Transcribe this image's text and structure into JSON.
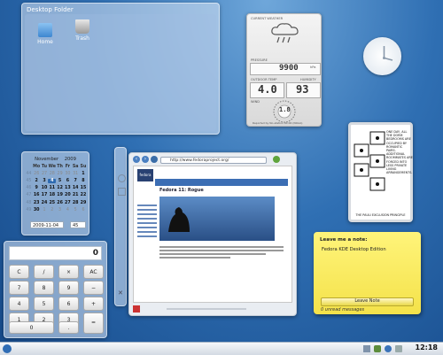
{
  "desktop_folder": {
    "title": "Desktop Folder",
    "icons": [
      {
        "label": "Home",
        "icon": "home-folder-icon"
      },
      {
        "label": "Trash",
        "icon": "trash-icon"
      }
    ]
  },
  "weather": {
    "title": "CURRENT WEATHER",
    "pressure_label": "PRESSURE",
    "pressure_value": "9900",
    "pressure_unit": "hPa",
    "outdoor_label": "OUTDOOR TEMP",
    "temp_value": "4.0",
    "humidity_label": "HUMIDITY",
    "humidity_value": "93",
    "wind_label": "WIND",
    "wind_value": "1.8",
    "footer": "Reported by No-station 00:00 (NOAA)",
    "icon": "rain-cloud-icon"
  },
  "calendar": {
    "month": "November",
    "year": "2009",
    "weekday_headers": [
      "Mo",
      "Tu",
      "We",
      "Th",
      "Fr",
      "Sa",
      "Su"
    ],
    "weeks": [
      {
        "wk": "44",
        "days": [
          "26",
          "27",
          "28",
          "29",
          "30",
          "31",
          "1"
        ]
      },
      {
        "wk": "45",
        "days": [
          "2",
          "3",
          "4",
          "5",
          "6",
          "7",
          "8"
        ]
      },
      {
        "wk": "46",
        "days": [
          "9",
          "10",
          "11",
          "12",
          "13",
          "14",
          "15"
        ]
      },
      {
        "wk": "47",
        "days": [
          "16",
          "17",
          "18",
          "19",
          "20",
          "21",
          "22"
        ]
      },
      {
        "wk": "48",
        "days": [
          "23",
          "24",
          "25",
          "26",
          "27",
          "28",
          "29"
        ]
      },
      {
        "wk": "49",
        "days": [
          "30",
          "1",
          "2",
          "3",
          "4",
          "5",
          "6"
        ]
      }
    ],
    "date_field": "2009-11-04",
    "week_field": "45"
  },
  "calculator": {
    "display": "0",
    "keys": [
      "C",
      "/",
      "×",
      "AC",
      "7",
      "8",
      "9",
      "−",
      "4",
      "5",
      "6",
      "+",
      "1",
      "2",
      "3",
      "=",
      "0",
      "."
    ]
  },
  "browser": {
    "url": "http://www.fedoraproject.org/",
    "page_heading": "Fedora 11: Rogue",
    "logo": "fedora"
  },
  "comic": {
    "text": "ONE DAY, ALL THE DORM BEDROOMS ARE OCCUPIED BY ROMANTIC PAIRS. ADDITIONAL ROOMMATES ARE FORCED INTO LESS PRIVATE LIVING ARRANGEMENTS.",
    "caption": "THE PAULI EXCLUSION PRINCIPLE"
  },
  "note": {
    "title": "Leave me a note:",
    "body": "Fedora KDE Desktop Edition",
    "button": "Leave Note",
    "count": "0 unread messages",
    "color": "#f6e75a"
  },
  "taskbar": {
    "time": "12:18"
  }
}
